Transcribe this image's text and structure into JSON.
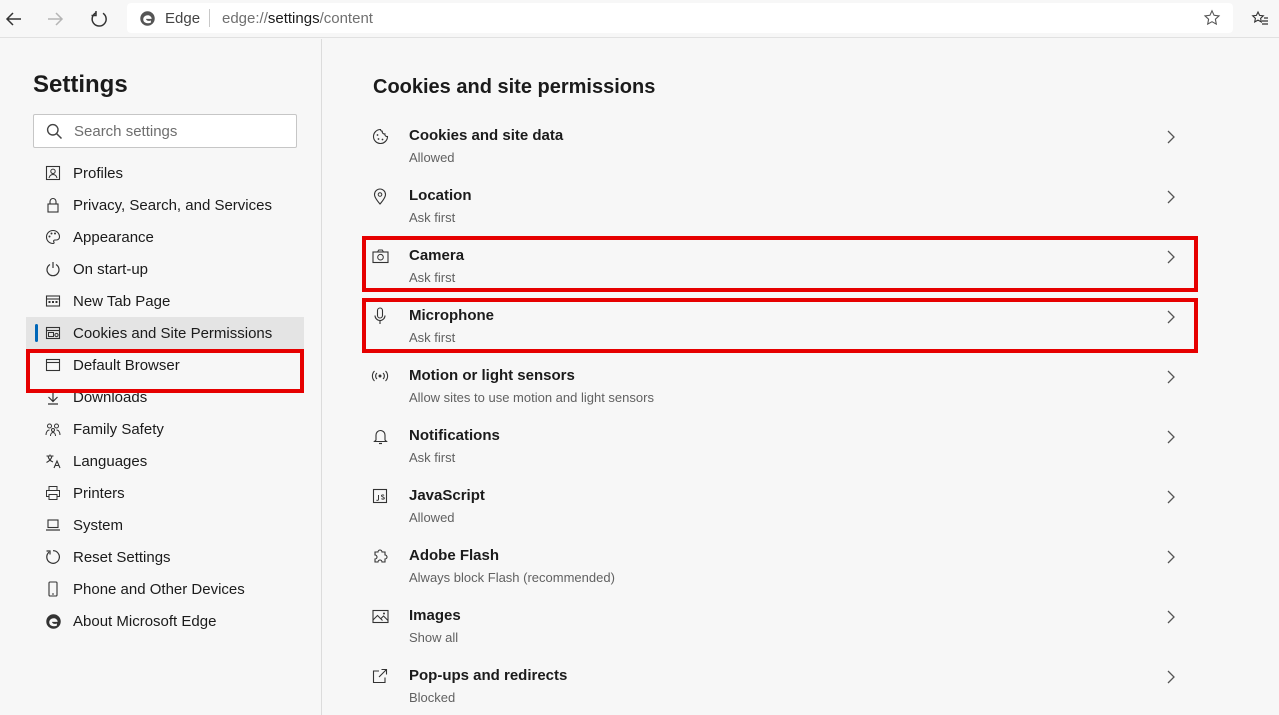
{
  "browser": {
    "site_label": "Edge",
    "url_prefix": "edge://",
    "url_main": "settings",
    "url_suffix": "/content"
  },
  "sidebar": {
    "title": "Settings",
    "search_placeholder": "Search settings",
    "items": [
      {
        "label": "Profiles",
        "icon": "profile-icon"
      },
      {
        "label": "Privacy, Search, and Services",
        "icon": "lock-icon"
      },
      {
        "label": "Appearance",
        "icon": "palette-icon"
      },
      {
        "label": "On start-up",
        "icon": "power-icon"
      },
      {
        "label": "New Tab Page",
        "icon": "newtab-icon"
      },
      {
        "label": "Cookies and Site Permissions",
        "icon": "cookies-permissions-icon",
        "active": true
      },
      {
        "label": "Default Browser",
        "icon": "default-browser-icon"
      },
      {
        "label": "Downloads",
        "icon": "download-icon"
      },
      {
        "label": "Family Safety",
        "icon": "family-icon"
      },
      {
        "label": "Languages",
        "icon": "languages-icon"
      },
      {
        "label": "Printers",
        "icon": "printer-icon"
      },
      {
        "label": "System",
        "icon": "laptop-icon"
      },
      {
        "label": "Reset Settings",
        "icon": "reset-icon"
      },
      {
        "label": "Phone and Other Devices",
        "icon": "phone-icon"
      },
      {
        "label": "About Microsoft Edge",
        "icon": "edge-logo-icon"
      }
    ]
  },
  "main": {
    "title": "Cookies and site permissions",
    "rows": [
      {
        "title": "Cookies and site data",
        "sub": "Allowed",
        "icon": "cookie-icon"
      },
      {
        "title": "Location",
        "sub": "Ask first",
        "icon": "location-pin-icon"
      },
      {
        "title": "Camera",
        "sub": "Ask first",
        "icon": "camera-icon"
      },
      {
        "title": "Microphone",
        "sub": "Ask first",
        "icon": "microphone-icon"
      },
      {
        "title": "Motion or light sensors",
        "sub": "Allow sites to use motion and light sensors",
        "icon": "sensor-icon"
      },
      {
        "title": "Notifications",
        "sub": "Ask first",
        "icon": "bell-icon"
      },
      {
        "title": "JavaScript",
        "sub": "Allowed",
        "icon": "javascript-icon"
      },
      {
        "title": "Adobe Flash",
        "sub": "Always block Flash (recommended)",
        "icon": "puzzle-icon"
      },
      {
        "title": "Images",
        "sub": "Show all",
        "icon": "image-icon"
      },
      {
        "title": "Pop-ups and redirects",
        "sub": "Blocked",
        "icon": "popup-icon"
      }
    ]
  },
  "colors": {
    "accent": "#0067b8",
    "highlight": "#e60000",
    "background": "#f7f7f7"
  }
}
